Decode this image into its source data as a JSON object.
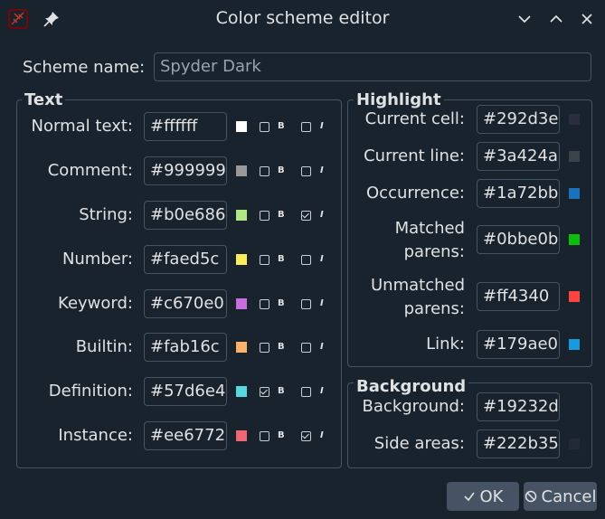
{
  "window": {
    "title": "Color scheme editor"
  },
  "scheme": {
    "label": "Scheme name:",
    "value": "Spyder Dark"
  },
  "text_group": {
    "title": "Text",
    "bold_tag": "B",
    "italic_tag": "I",
    "rows": [
      {
        "label": "Normal text:",
        "hex": "#ffffff",
        "color": "#ffffff",
        "bold": false,
        "italic": false
      },
      {
        "label": "Comment:",
        "hex": "#999999",
        "color": "#999999",
        "bold": false,
        "italic": false
      },
      {
        "label": "String:",
        "hex": "#b0e686",
        "color": "#b0e686",
        "bold": false,
        "italic": true
      },
      {
        "label": "Number:",
        "hex": "#faed5c",
        "color": "#faed5c",
        "bold": false,
        "italic": false
      },
      {
        "label": "Keyword:",
        "hex": "#c670e0",
        "color": "#c670e0",
        "bold": false,
        "italic": false
      },
      {
        "label": "Builtin:",
        "hex": "#fab16c",
        "color": "#fab16c",
        "bold": false,
        "italic": false
      },
      {
        "label": "Definition:",
        "hex": "#57d6e4",
        "color": "#57d6e4",
        "bold": true,
        "italic": false
      },
      {
        "label": "Instance:",
        "hex": "#ee6772",
        "color": "#ee6772",
        "bold": false,
        "italic": true
      }
    ]
  },
  "highlight_group": {
    "title": "Highlight",
    "rows": [
      {
        "label": "Current cell:",
        "hex": "#292d3e",
        "color": "#292d3e"
      },
      {
        "label": "Current line:",
        "hex": "#3a424a",
        "color": "#3a424a"
      },
      {
        "label": "Occurrence:",
        "hex": "#1a72bb",
        "color": "#1a72bb"
      },
      {
        "label_line1": "Matched",
        "label_line2": "parens:",
        "hex": "#0bbe0b",
        "color": "#0bbe0b"
      },
      {
        "label_line1": "Unmatched",
        "label_line2": "parens:",
        "hex": "#ff4340",
        "color": "#ff4340"
      },
      {
        "label": "Link:",
        "hex": "#179ae0",
        "color": "#179ae0"
      }
    ]
  },
  "background_group": {
    "title": "Background",
    "rows": [
      {
        "label": "Background:",
        "hex": "#19232d",
        "color": "#19232d"
      },
      {
        "label": "Side areas:",
        "hex": "#222b35",
        "color": "#222b35"
      }
    ]
  },
  "buttons": {
    "ok": "OK",
    "cancel": "Cancel"
  }
}
